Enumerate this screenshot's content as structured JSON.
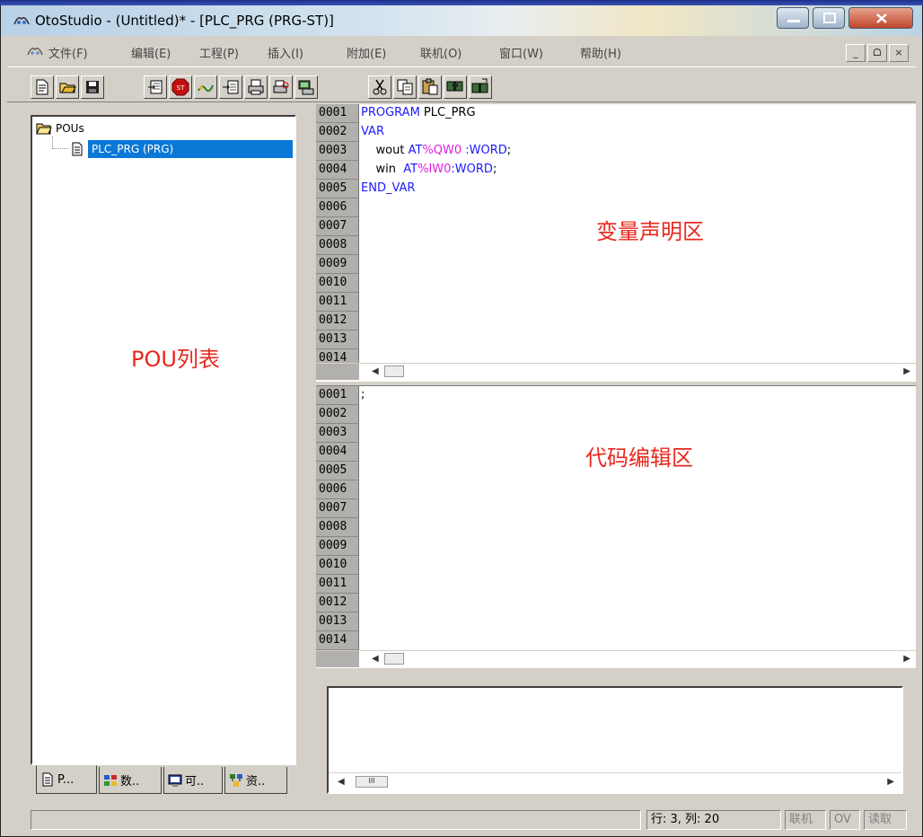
{
  "window": {
    "title": "OtoStudio - (Untitled)* - [PLC_PRG (PRG-ST)]",
    "app_icon": "otostudio-logo-icon"
  },
  "caption_buttons": {
    "minimize": "minimize-icon",
    "maximize": "maximize-icon",
    "close": "close-icon"
  },
  "menu": {
    "items": [
      "文件(F)",
      "编辑(E)",
      "工程(P)",
      "插入(I)",
      "附加(E)",
      "联机(O)",
      "窗口(W)",
      "帮助(H)"
    ],
    "mdi_buttons": [
      "_",
      "ᗝ",
      "×"
    ]
  },
  "toolbar": {
    "buttons": [
      "new-icon",
      "open-icon",
      "save-icon",
      "build-icon",
      "stop-icon",
      "run-icon",
      "download-icon",
      "print-icon",
      "print-preview-icon",
      "online-icon",
      "cut-icon",
      "copy-icon",
      "paste-icon",
      "find-icon",
      "replace-icon"
    ]
  },
  "tree": {
    "root": "POUs",
    "child": "PLC_PRG (PRG)"
  },
  "left_annotation": "POU列表",
  "bottom_tabs": [
    "P...",
    "数..",
    "可..",
    "资.."
  ],
  "declaration_editor": {
    "line_numbers": [
      "0001",
      "0002",
      "0003",
      "0004",
      "0005",
      "0006",
      "0007",
      "0008",
      "0009",
      "0010",
      "0011",
      "0012",
      "0013",
      "0014"
    ],
    "lines": {
      "l1_kw": "PROGRAM",
      "l1_name": " PLC_PRG",
      "l2_kw": "VAR",
      "l3_var": "    wout ",
      "l3_at": "AT",
      "l3_addr": "%QW0",
      "l3_type": " :WORD",
      "l3_end": ";",
      "l4_var": "    win  ",
      "l4_at": "AT",
      "l4_addr": "%IW0",
      "l4_type": ":WORD",
      "l4_end": ";",
      "l5_kw": "END_VAR"
    },
    "annotation": "变量声明区"
  },
  "code_editor": {
    "line_numbers": [
      "0001",
      "0002",
      "0003",
      "0004",
      "0005",
      "0006",
      "0007",
      "0008",
      "0009",
      "0010",
      "0011",
      "0012",
      "0013",
      "0014"
    ],
    "line1": ";",
    "annotation": "代码编辑区"
  },
  "scrollbar": {
    "thumb_label": "III"
  },
  "status_bar": {
    "position": "行: 3, 列: 20",
    "online": "联机",
    "ov": "OV",
    "read": "读取"
  },
  "colors": {
    "keyword": "#1a1aff",
    "address": "#e51be5",
    "annotation": "#e8281e",
    "selection": "#0a78d7"
  }
}
